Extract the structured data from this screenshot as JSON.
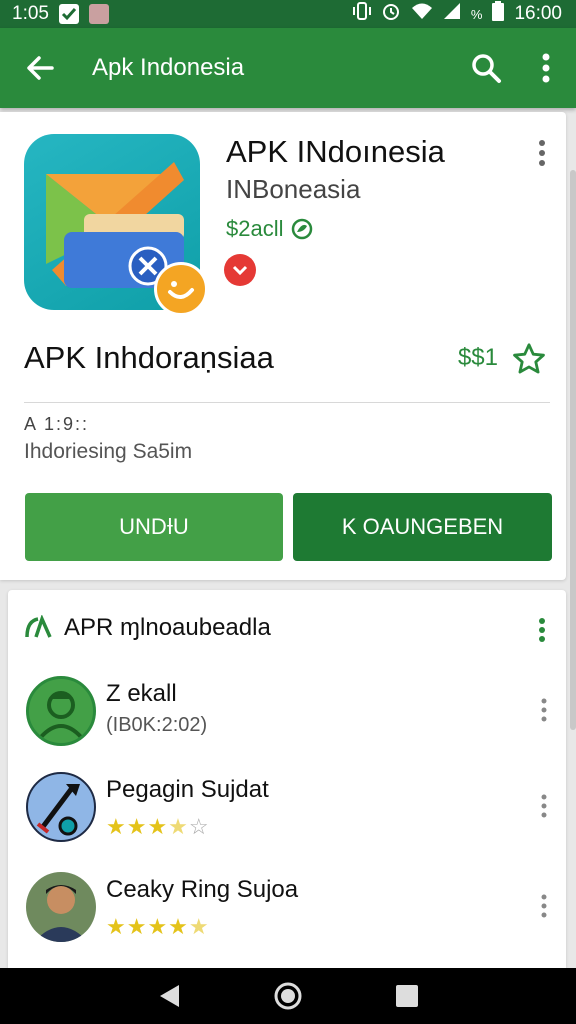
{
  "status_bar": {
    "time_left": "1:05",
    "time_right": "16:00",
    "battery_text": "%"
  },
  "app_bar": {
    "title": "Apk Indonesia",
    "icons": [
      "back-arrow-icon",
      "search-icon",
      "more-vert-icon"
    ]
  },
  "app_card": {
    "name": "APK INdoınesia",
    "developer": "INBoneasia",
    "price": "$2acll",
    "secondary_title": "APK Inhdoraṇsiaa",
    "secondary_price": "$$1",
    "meta_line": "A 1:9::",
    "meta_subtitle": "Ihdoriesing Sa5im",
    "install_label": "UNDƗU",
    "open_label": "K OAUNGEBEN"
  },
  "section": {
    "title": "APR ɱlnoaubeadla",
    "items": [
      {
        "title": "Z ekall",
        "subtitle": "(IB0K:2:02)",
        "rating": null
      },
      {
        "title": "Pegagin Sujdat",
        "subtitle": null,
        "rating": 3.5
      },
      {
        "title": "Ceaky Ring Sujoa",
        "subtitle": null,
        "rating": 4.5
      }
    ]
  },
  "colors": {
    "status_bar": "#1e6b34",
    "app_bar": "#2a8a3c",
    "accent_green": "#2a8a3c",
    "install_button": "#43a047",
    "open_button": "#1e7a33",
    "star_fill": "#e4c31a"
  }
}
